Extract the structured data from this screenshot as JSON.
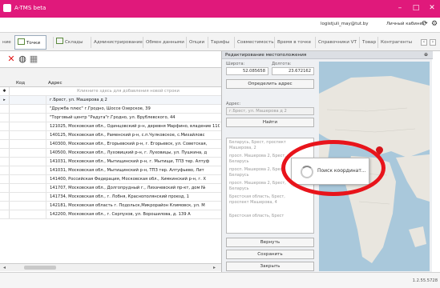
{
  "app": {
    "title": "A-TMS beta",
    "controls": {
      "minimize": "–",
      "maximize": "□",
      "close": "✕"
    }
  },
  "user": {
    "email": "logistjuli_may@tut.by",
    "cabinet_label": "Личный кабинет"
  },
  "tabs": [
    {
      "label": "ние"
    },
    {
      "label": "Точки",
      "active": true
    },
    {
      "label": "Склады"
    },
    {
      "label": "Администрирование"
    },
    {
      "label": "Обмен данными"
    },
    {
      "label": "Опции"
    },
    {
      "label": "Тарифы"
    },
    {
      "label": "Совместимость"
    },
    {
      "label": "Время в точке"
    },
    {
      "label": "Справочники VT"
    },
    {
      "label": "Товар"
    },
    {
      "label": "Контрагенты"
    }
  ],
  "toolbar": {
    "icons": [
      "delete-icon",
      "globe-icon",
      "grid-icon"
    ]
  },
  "grid": {
    "columns": {
      "code": "Код",
      "address": "Адрес"
    },
    "new_row_hint": "Кликните здесь для добавления новой строки",
    "rows": [
      {
        "address": "г.Брест, ул. Машерова д 2"
      },
      {
        "address": "\"Дружба плюс\" г.Гродно, Шоссе Озерское, 39"
      },
      {
        "address": "\"Торговый центр \"Радуга\"г.Гродно, ул. Врублевского, 44"
      },
      {
        "address": "121025, Московская обл., Одинцовский р-н, деревня Марфино, владение 11С"
      },
      {
        "address": "140125, Московская обл., Раменский р-н, с.п.Чулковское, с.Михайловс"
      },
      {
        "address": "140300, Московская обл., Егорьевский р-н, г. Егорьевск, ул. Советская,"
      },
      {
        "address": "140500, Московская обл., Луховицкий р-н, г. Луховицы, ул. Пушкина, д"
      },
      {
        "address": "141031, Московская обл., Мытищинский р-н, г. Мытищи, ТПЗ тер. Алтуф"
      },
      {
        "address": "141031, Московская обл., Мытищинский р-н, ТПЗ тер. Алтуфьево, Лит"
      },
      {
        "address": "141400, Российская Федерация, Московская обл., Химкинский р-н, г. Х"
      },
      {
        "address": "141707, Московская обл., Долгопрудный г., Лихачевский пр-кт, дом №"
      },
      {
        "address": "141734, Московская обл., г. Лобня, Краснополянский проезд, 1"
      },
      {
        "address": "142181, Московская область г. Подольск,Микрорайон Климовск, ул. М"
      },
      {
        "address": "142200, Московская обл., г. Серпухов, ул. Ворошилова, д. 139 А"
      }
    ]
  },
  "panel": {
    "title": "Редактирование местоположения",
    "latitude_label": "Широта:",
    "latitude_value": "52.085658",
    "longitude_label": "Долгота:",
    "longitude_value": "23.672162",
    "determine_button": "Определить адрес",
    "address_label": "Адрес:",
    "address_value": "г.Брест, ул. Машерова д 2",
    "find_button": "Найти",
    "results": [
      "Беларусь, Брест, проспект Машерова, 2",
      "просп. Машерова 2, Брест, Беларусь",
      "просп. Машерова 2, Брест, Беларусь",
      "просп. Машерова 2, Брест, Беларусь",
      "Брестская область, Брест, проспект Машерова, 4",
      "Брестская область, Брест"
    ],
    "return_button": "Вернуть",
    "save_button": "Сохранить",
    "close_button": "Закрыть",
    "map_popup": "Поиск координат..."
  },
  "status": {
    "version": "1.2.55.5728"
  }
}
